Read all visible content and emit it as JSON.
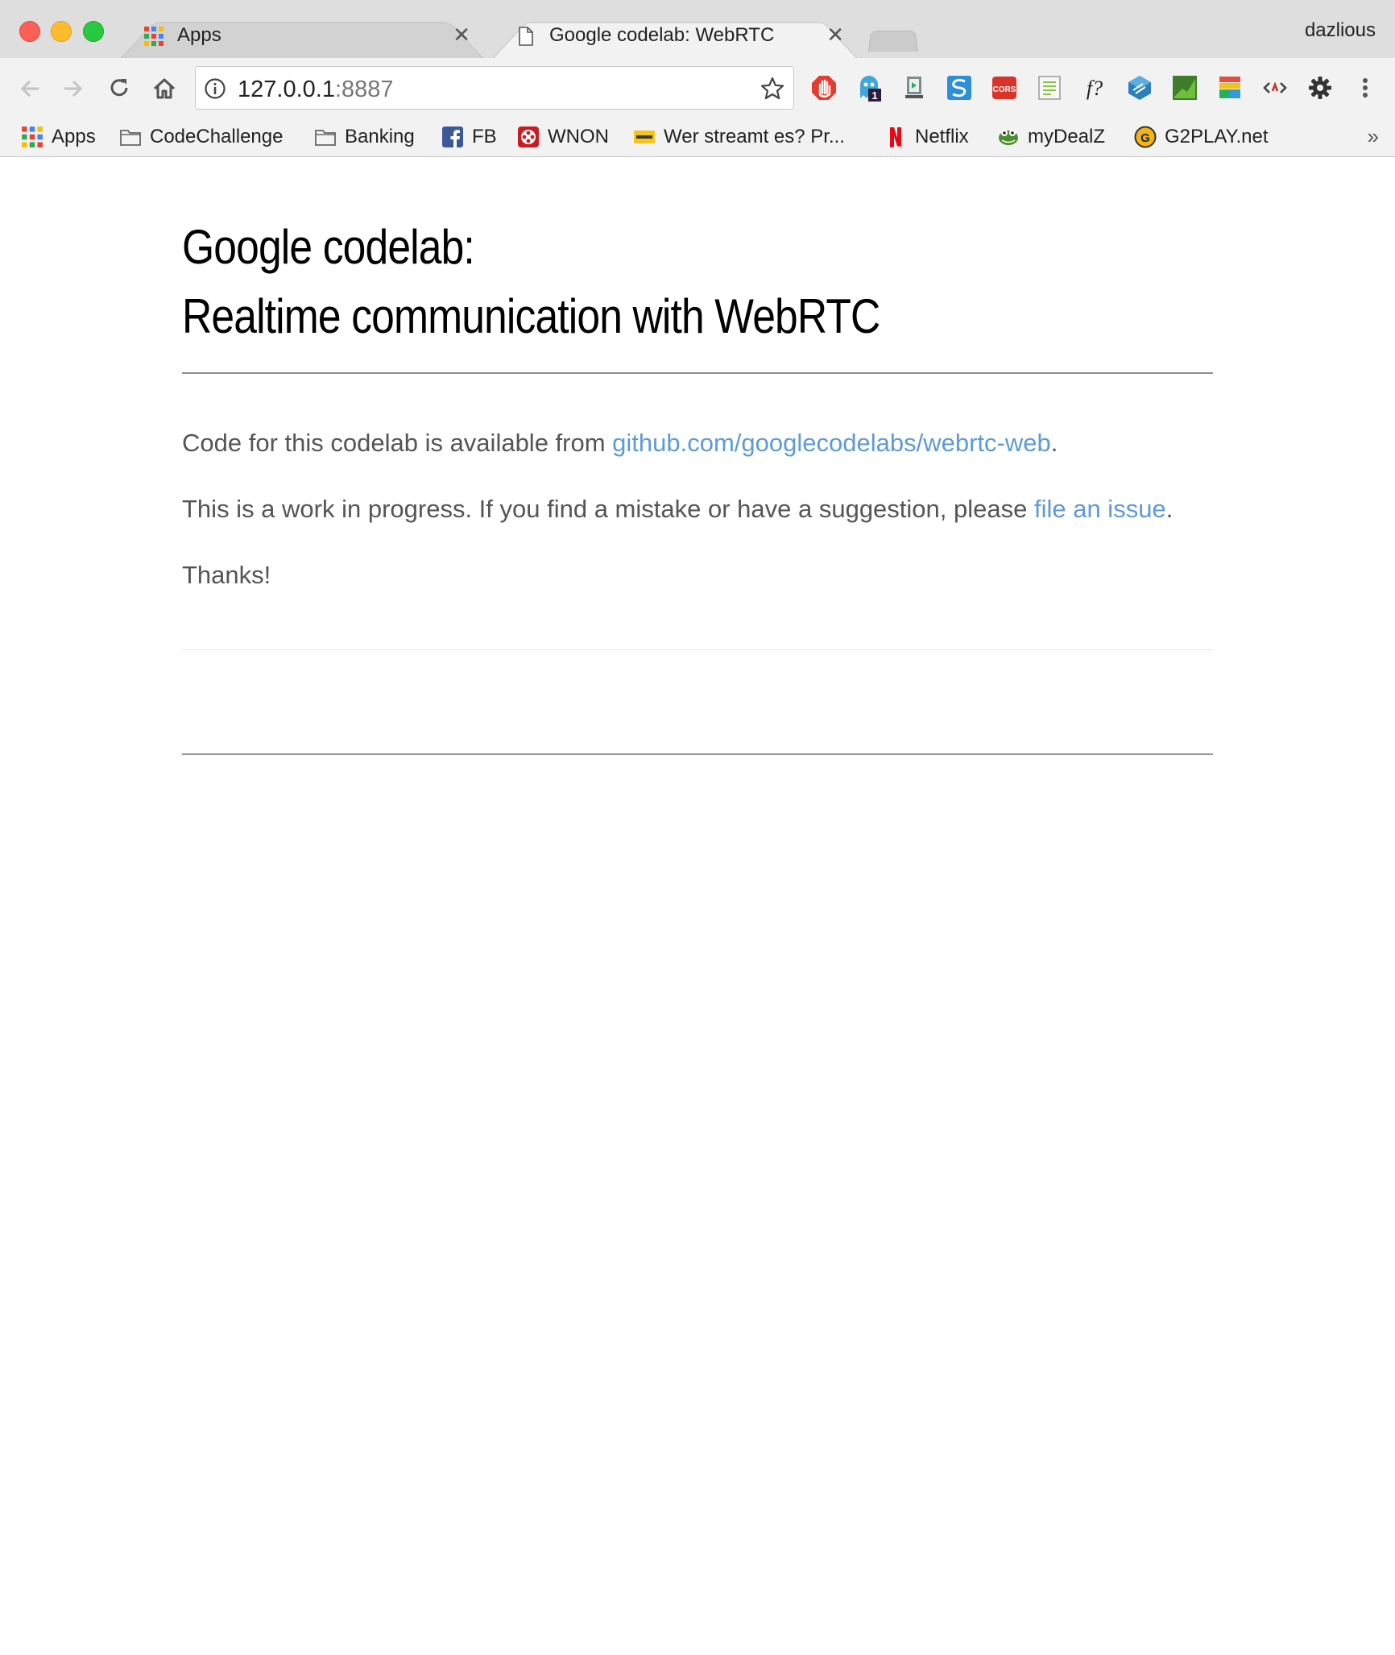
{
  "window": {
    "tabs": [
      {
        "title": "Apps",
        "close": "✕"
      },
      {
        "title": "Google codelab: WebRTC",
        "close": "✕"
      }
    ],
    "profile_name": "dazlious"
  },
  "toolbar": {
    "url_host": "127.0.0.1",
    "url_port": ":8887"
  },
  "bookmarks": {
    "items": [
      {
        "label": "Apps",
        "icon": "apps-grid-icon"
      },
      {
        "label": "CodeChallenge",
        "icon": "folder-icon"
      },
      {
        "label": "Banking",
        "icon": "folder-icon"
      },
      {
        "label": "FB",
        "icon": "facebook-icon"
      },
      {
        "label": "WNON",
        "icon": "film-reel-icon"
      },
      {
        "label": "Wer streamt es? Pr...",
        "icon": "ticket-icon"
      },
      {
        "label": "Netflix",
        "icon": "netflix-icon"
      },
      {
        "label": "myDealZ",
        "icon": "crocodile-icon"
      },
      {
        "label": "G2PLAY.net",
        "icon": "g2play-icon"
      }
    ],
    "more": "»"
  },
  "page": {
    "title_line1": "Google codelab:",
    "title_line2": "Realtime communication with WebRTC",
    "p1_text": "Code for this codelab is available from ",
    "p1_link": "github.com/googlecodelabs/webrtc-web",
    "p1_end": ".",
    "p2_text": "This is a work in progress. If you find a mistake or have a suggestion, please ",
    "p2_link": "file an issue",
    "p2_end": ".",
    "p3_text": "Thanks!"
  },
  "colors": {
    "link": "#5c9bd8",
    "body_text": "#555555",
    "heading": "#000000"
  }
}
